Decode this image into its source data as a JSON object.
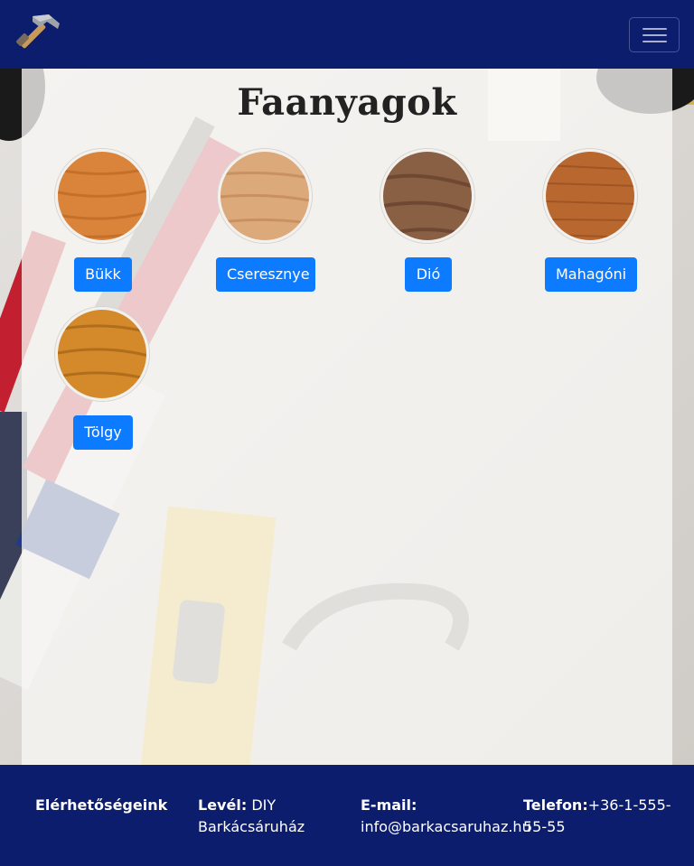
{
  "navbar": {
    "logo_icon": "hammer-icon",
    "toggle_icon": "menu-icon"
  },
  "page": {
    "title": "Faanyagok"
  },
  "woods": [
    {
      "label": "Bükk",
      "color": "#d9843a"
    },
    {
      "label": "Cseresznye",
      "color": "#dca97a"
    },
    {
      "label": "Dió",
      "color": "#8a6045"
    },
    {
      "label": "Mahagóni",
      "color": "#b8672f"
    },
    {
      "label": "Tölgy",
      "color": "#d48a2a"
    }
  ],
  "footer": {
    "heading": "Elérhetőségeink",
    "mail_label": "Levél:",
    "mail_value": "DIY Barkácsáruház",
    "email_label": "E-mail:",
    "email_value": "info@barkacsaruhaz.hu",
    "phone_label": "Telefon:",
    "phone_value": "+36-1-555-55-55"
  },
  "colors": {
    "navbar_bg": "#0d1d6e",
    "button_bg": "#0d7bff"
  }
}
